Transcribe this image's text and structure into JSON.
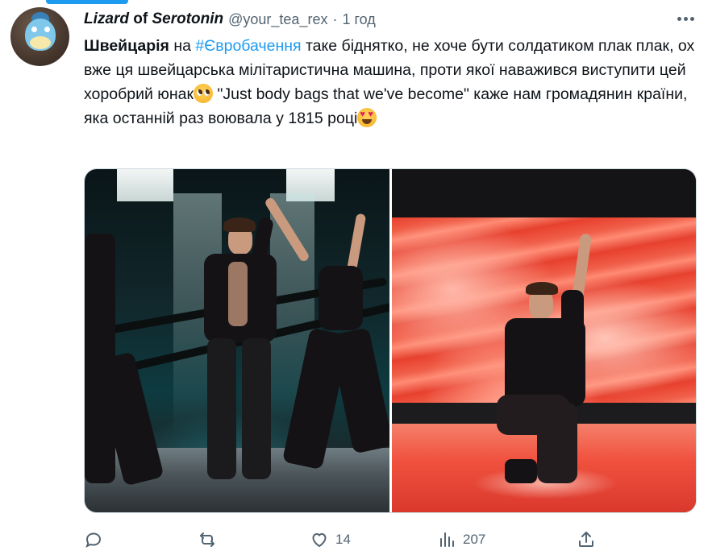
{
  "tweet": {
    "author": {
      "name_part1": "Lizard",
      "name_part2": " of ",
      "name_part3": "Serotonin",
      "handle": "@your_tea_rex",
      "separator": "·",
      "time": "1 год"
    },
    "text": {
      "bold_word": "Швейцарія",
      "segment1": " на ",
      "hashtag": "#Євробачення",
      "segment2": " таке біднятко, не хоче бути солдатиком плак плак, ох вже ця швейцарська мілітаристична машина, проти якої наважився виступити цей хоробрий юнак",
      "segment3": " \"Just body bags that we've become\" каже нам громадянин країни, яка останній раз воювала у 1815 році"
    },
    "emojis": [
      "pleading-face-emoji",
      "heart-eyes-emoji"
    ],
    "media": {
      "count": 2
    },
    "actions": {
      "reply_count": "",
      "retweet_count": "",
      "like_count": "14",
      "views_count": "207"
    },
    "colors": {
      "accent": "#1d9bf0",
      "secondary_text": "#536471"
    }
  }
}
